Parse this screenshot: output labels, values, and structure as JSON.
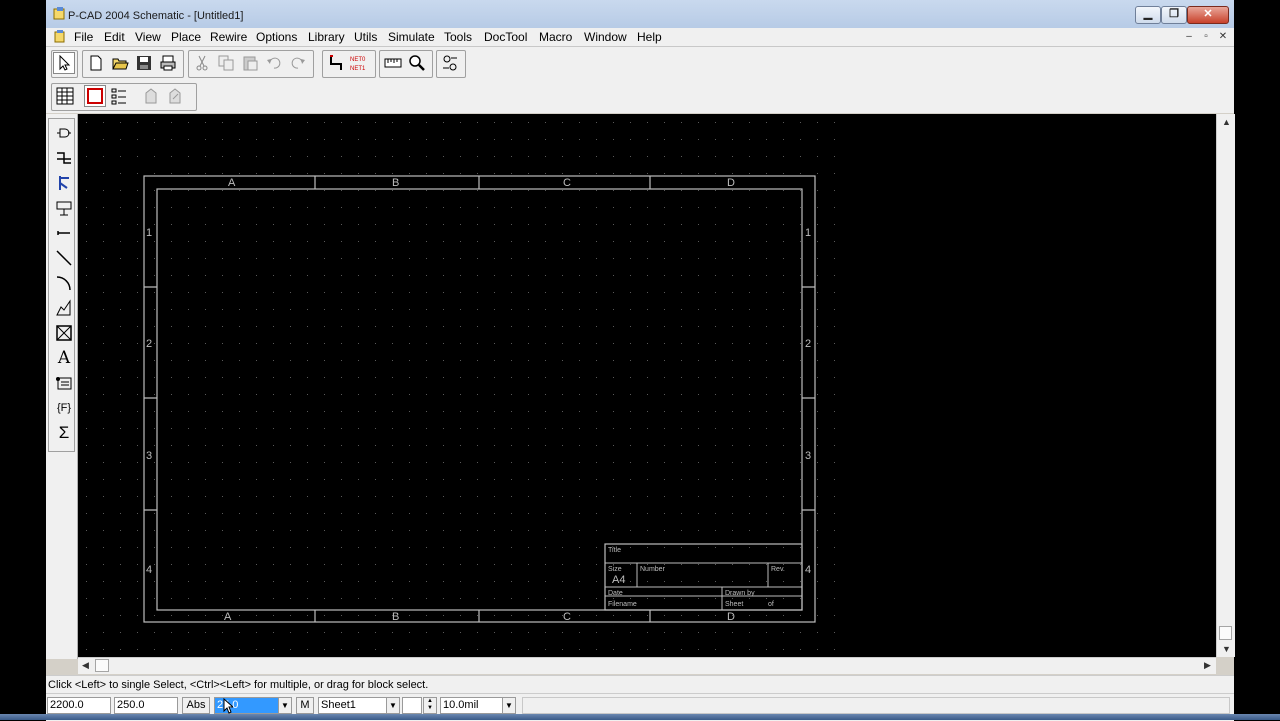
{
  "window": {
    "title": "P-CAD 2004 Schematic - [Untitled1]",
    "caption_buttons": {
      "minimize": "▁",
      "maximize": "❐",
      "close": "✕"
    }
  },
  "menubar": {
    "items": [
      "File",
      "Edit",
      "View",
      "Place",
      "Rewire",
      "Options",
      "Library",
      "Utils",
      "Simulate",
      "Tools",
      "DocTool",
      "Macro",
      "Window",
      "Help"
    ],
    "mdi_buttons": [
      "–",
      "▫",
      "✕"
    ]
  },
  "toolbar1": {
    "icons": [
      "select-arrow-icon",
      "new-file-icon",
      "open-folder-icon",
      "save-icon",
      "print-icon",
      "cut-icon",
      "copy-icon",
      "paste-icon",
      "undo-icon",
      "redo-icon",
      "net-route-icon",
      "net-to-net-icon",
      "ruler-icon",
      "zoom-icon",
      "swap-icon"
    ],
    "net_label_top": "NET0",
    "net_label_bottom": "NET1"
  },
  "toolbar2": {
    "icons": [
      "grid-table-icon",
      "sheet-frame-icon",
      "list-icon",
      "component-icon",
      "component-edit-icon"
    ]
  },
  "left_toolbar": {
    "icons": [
      "place-part-icon",
      "place-wire-icon",
      "place-bus-icon",
      "place-port-icon",
      "place-pin-icon",
      "place-line-icon",
      "place-arc-icon",
      "place-polygon-icon",
      "place-field-icon",
      "place-text-icon",
      "place-attribute-icon",
      "place-field-f-icon",
      "place-ieee-sum-icon"
    ],
    "text_glyph": "A",
    "field_glyph": "{F}",
    "sum_glyph": "Σ"
  },
  "sheet": {
    "columns": [
      "A",
      "B",
      "C",
      "D"
    ],
    "rows": [
      "1",
      "2",
      "3",
      "4"
    ],
    "title_block": {
      "title_label": "Title",
      "size_label": "Size",
      "size_value": "A4",
      "number_label": "Number",
      "rev_label": "Rev.",
      "date_label": "Date",
      "drawn_by_label": "Drawn by",
      "filename_label": "Filename",
      "sheet_label": "Sheet",
      "of_label": "of"
    }
  },
  "status": {
    "prompt": "Click <Left> to single Select, <Ctrl><Left> for multiple, or drag for block select.",
    "x_coord": "2200.0",
    "y_coord": "250.0",
    "abs_button": "Abs",
    "grid_value": "25.0",
    "m_button": "M",
    "sheet_select": "Sheet1",
    "layer_box": "",
    "line_width": "10.0mil"
  },
  "colors": {
    "canvas_bg": "#000000",
    "grid_dot": "#5a5a5a",
    "sheet_border": "#bdbdbd",
    "chrome": "#f0f0f0",
    "selection": "#3399ff"
  }
}
